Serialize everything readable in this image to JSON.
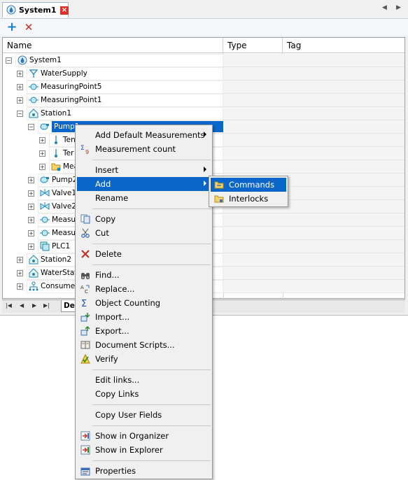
{
  "tab": {
    "title": "System1",
    "close": "×",
    "prev": "◀",
    "next": "▶"
  },
  "toolbar": {
    "add": "+",
    "delete": "✕"
  },
  "grid": {
    "columns": [
      "Name",
      "Type",
      "Tag"
    ],
    "rows": [
      {
        "label": "System1",
        "icon": "system-icon"
      },
      {
        "label": "WaterSupply",
        "icon": "water-supply-icon"
      },
      {
        "label": "MeasuringPoint5",
        "icon": "measuring-point-icon"
      },
      {
        "label": "MeasuringPoint1",
        "icon": "measuring-point-icon"
      },
      {
        "label": "Station1",
        "icon": "station-icon"
      },
      {
        "label": "Pump1",
        "icon": "pump-icon"
      },
      {
        "label": "Ten",
        "icon": "sensor-icon"
      },
      {
        "label": "Ter",
        "icon": "sensor-icon"
      },
      {
        "label": "Mea",
        "icon": "folder-icon"
      },
      {
        "label": "Pump2",
        "icon": "pump-icon"
      },
      {
        "label": "Valve1",
        "icon": "valve-icon"
      },
      {
        "label": "Valve2",
        "icon": "valve-icon"
      },
      {
        "label": "Measur",
        "icon": "measuring-point-icon"
      },
      {
        "label": "Measur",
        "icon": "measuring-point-icon"
      },
      {
        "label": "PLC1",
        "icon": "plc-icon"
      },
      {
        "label": "Station2",
        "icon": "station-icon"
      },
      {
        "label": "WaterStat",
        "icon": "station-icon"
      },
      {
        "label": "Consumer",
        "icon": "consumer-icon"
      }
    ]
  },
  "bottom": {
    "first": "|◀",
    "prev": "◀",
    "next": "▶",
    "last": "▶|",
    "sheet_tab": "Des"
  },
  "menu": {
    "items": [
      {
        "label": "Add Default Measurements",
        "icon": "",
        "submenu": true
      },
      {
        "label": "Measurement count",
        "icon": "sigma-count-icon"
      },
      {
        "label": "Insert",
        "icon": "",
        "submenu": true
      },
      {
        "label": "Add",
        "icon": "",
        "submenu": true
      },
      {
        "label": "Rename",
        "icon": ""
      },
      {
        "label": "Copy",
        "icon": "copy-icon"
      },
      {
        "label": "Cut",
        "icon": "scissors-icon"
      },
      {
        "label": "Delete",
        "icon": "delete-icon"
      },
      {
        "label": "Find...",
        "icon": "binoculars-icon"
      },
      {
        "label": "Replace...",
        "icon": "replace-icon"
      },
      {
        "label": "Object Counting",
        "icon": "sigma-icon"
      },
      {
        "label": "Import...",
        "icon": "import-icon"
      },
      {
        "label": "Export...",
        "icon": "export-icon"
      },
      {
        "label": "Document Scripts...",
        "icon": "book-icon"
      },
      {
        "label": "Verify",
        "icon": "verify-icon"
      },
      {
        "label": "Edit links...",
        "icon": ""
      },
      {
        "label": "Copy Links",
        "icon": ""
      },
      {
        "label": "Copy User Fields",
        "icon": ""
      },
      {
        "label": "Show in Organizer",
        "icon": "organizer-icon"
      },
      {
        "label": "Show in Explorer",
        "icon": "explorer-icon"
      },
      {
        "label": "Properties",
        "icon": "properties-icon"
      }
    ]
  },
  "submenu": {
    "items": [
      {
        "label": "Commands",
        "icon": "commands-folder-icon"
      },
      {
        "label": "Interlocks",
        "icon": "interlocks-folder-icon"
      }
    ]
  },
  "colors": {
    "selection": "#0a66c8",
    "accent": "#1a7fd0",
    "delete": "#c0302a"
  }
}
